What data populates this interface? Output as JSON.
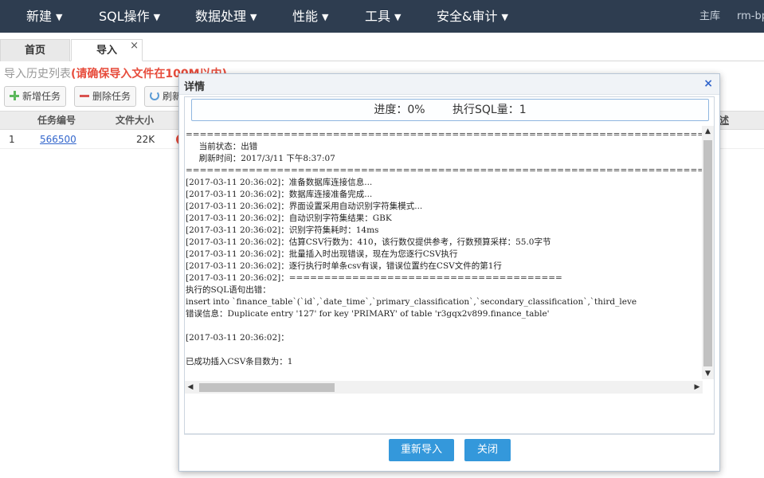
{
  "topnav": {
    "menus": [
      "新建",
      "SQL操作",
      "数据处理",
      "性能",
      "工具",
      "安全&审计"
    ],
    "right_items": [
      "主库",
      "rm-bp"
    ]
  },
  "tabs": {
    "home": "首页",
    "import": "导入",
    "close": "×"
  },
  "page": {
    "history_title": "导入历史列表",
    "history_warn": "(请确保导入文件在100M以内)",
    "toolbar": {
      "add": "新增任务",
      "delete": "删除任务",
      "refresh": "刷新"
    },
    "grid": {
      "headers": [
        "任务编号",
        "文件大小"
      ],
      "extra_header": "述",
      "rows": [
        {
          "index": "1",
          "task_id": "566500",
          "size": "22K"
        }
      ]
    }
  },
  "modal": {
    "title": "详情",
    "close": "×",
    "progress": "进度：0%",
    "sql_count": "执行SQL量：1",
    "log_lines": [
      "==========================================================================",
      "     当前状态：出错",
      "     刷新时间：2017/3/11 下午8:37:07",
      "==========================================================================",
      "[2017-03-11 20:36:02]：准备数据库连接信息...",
      "[2017-03-11 20:36:02]：数据库连接准备完成...",
      "[2017-03-11 20:36:02]：界面设置采用自动识别字符集模式...",
      "[2017-03-11 20:36:02]：自动识别字符集结果：GBK",
      "[2017-03-11 20:36:02]：识别字符集耗时：14ms",
      "[2017-03-11 20:36:02]：估算CSV行数为：410，该行数仅提供参考，行数预算采样：55.0字节",
      "[2017-03-11 20:36:02]：批量插入时出现错误，现在为您逐行CSV执行",
      "[2017-03-11 20:36:02]：逐行执行时单条csv有误，错误位置约在CSV文件的第1行",
      "[2017-03-11 20:36:02]：=======================================",
      "执行的SQL语句出错：",
      "insert into `finance_table`(`id`,`date_time`,`primary_classification`,`secondary_classification`,`third_leve",
      "错误信息：Duplicate entry '127' for key 'PRIMARY' of table 'r3gqx2v899.finance_table'",
      "",
      "[2017-03-11 20:36:02]：",
      "",
      "已成功插入CSV条目数为：1"
    ],
    "buttons": {
      "reimport": "重新导入",
      "close": "关闭"
    }
  },
  "colors": {
    "nav_bg": "#2e3d50",
    "primary": "#3498db",
    "warn": "#e74c3c",
    "link": "#3366cc"
  }
}
